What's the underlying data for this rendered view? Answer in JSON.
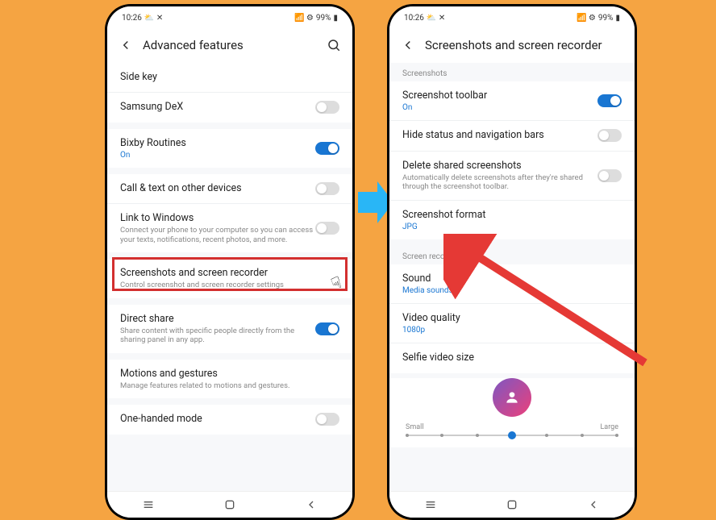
{
  "status": {
    "time": "10:26",
    "battery": "99%"
  },
  "phone1": {
    "title": "Advanced features",
    "items": [
      {
        "title": "Side key"
      },
      {
        "title": "Samsung DeX",
        "toggle": "off"
      },
      {
        "title": "Bixby Routines",
        "value": "On",
        "toggle": "on"
      },
      {
        "title": "Call & text on other devices",
        "toggle": "off"
      },
      {
        "title": "Link to Windows",
        "sub": "Connect your phone to your computer so you can access your texts, notifications, recent photos, and more.",
        "toggle": "off"
      },
      {
        "title": "Screenshots and screen recorder",
        "sub": "Control screenshot and screen recorder settings"
      },
      {
        "title": "Direct share",
        "sub": "Share content with specific people directly from the sharing panel in any app.",
        "toggle": "on"
      },
      {
        "title": "Motions and gestures",
        "sub": "Manage features related to motions and gestures."
      },
      {
        "title": "One-handed mode",
        "toggle": "off"
      }
    ]
  },
  "phone2": {
    "title": "Screenshots and screen recorder",
    "section1": "Screenshots",
    "items1": [
      {
        "title": "Screenshot toolbar",
        "value": "On",
        "toggle": "on"
      },
      {
        "title": "Hide status and navigation bars",
        "toggle": "off"
      },
      {
        "title": "Delete shared screenshots",
        "sub": "Automatically delete screenshots after they're shared through the screenshot toolbar.",
        "toggle": "off"
      },
      {
        "title": "Screenshot format",
        "value": "JPG"
      }
    ],
    "section2": "Screen recorder",
    "items2": [
      {
        "title": "Sound",
        "value": "Media sounds"
      },
      {
        "title": "Video quality",
        "value": "1080p"
      },
      {
        "title": "Selfie video size"
      }
    ],
    "slider": {
      "min": "Small",
      "max": "Large"
    }
  }
}
